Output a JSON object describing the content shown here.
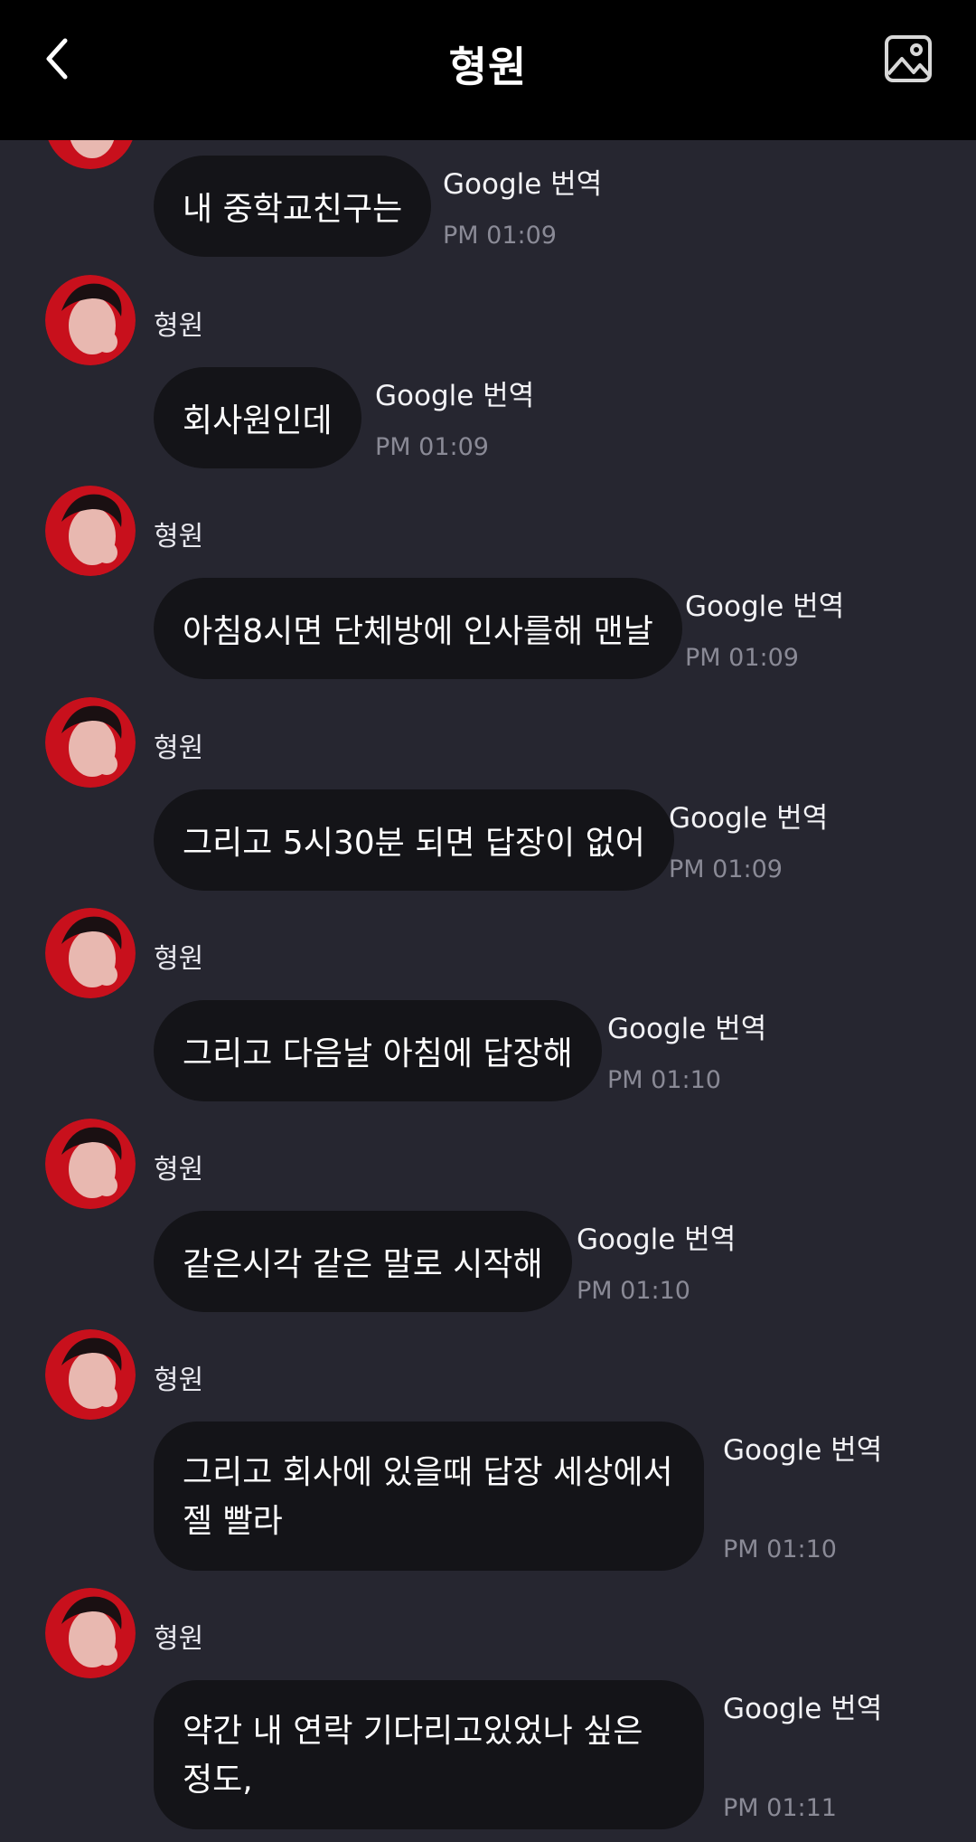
{
  "header": {
    "title": "형원",
    "back_icon": "chevron-left-icon",
    "gallery_icon": "image-icon"
  },
  "colors": {
    "header_bg": "#000000",
    "chat_bg": "#262630",
    "bubble_bg": "#141418",
    "time_text": "#8a8a96",
    "avatar_accent": "#c8101c"
  },
  "messages": [
    {
      "sender": "",
      "text": "내 중학교친구는",
      "translate": "Google 번역",
      "time": "PM 01:09"
    },
    {
      "sender": "형원",
      "text": "회사원인데",
      "translate": "Google 번역",
      "time": "PM 01:09"
    },
    {
      "sender": "형원",
      "text": "아침8시면 단체방에 인사를해 맨날",
      "translate": "Google 번역",
      "time": "PM 01:09"
    },
    {
      "sender": "형원",
      "text": "그리고 5시30분 되면 답장이 없어",
      "translate": "Google 번역",
      "time": "PM 01:09"
    },
    {
      "sender": "형원",
      "text": "그리고 다음날 아침에 답장해",
      "translate": "Google 번역",
      "time": "PM 01:10"
    },
    {
      "sender": "형원",
      "text": "같은시각 같은 말로 시작해",
      "translate": "Google 번역",
      "time": "PM 01:10"
    },
    {
      "sender": "형원",
      "text": "그리고 회사에 있을때 답장 세상에서 젤 빨라",
      "translate": "Google 번역",
      "time": "PM 01:10"
    },
    {
      "sender": "형원",
      "text": "약간 내 연락 기다리고있었나 싶은 정도,",
      "translate": "Google 번역",
      "time": "PM 01:11"
    }
  ]
}
